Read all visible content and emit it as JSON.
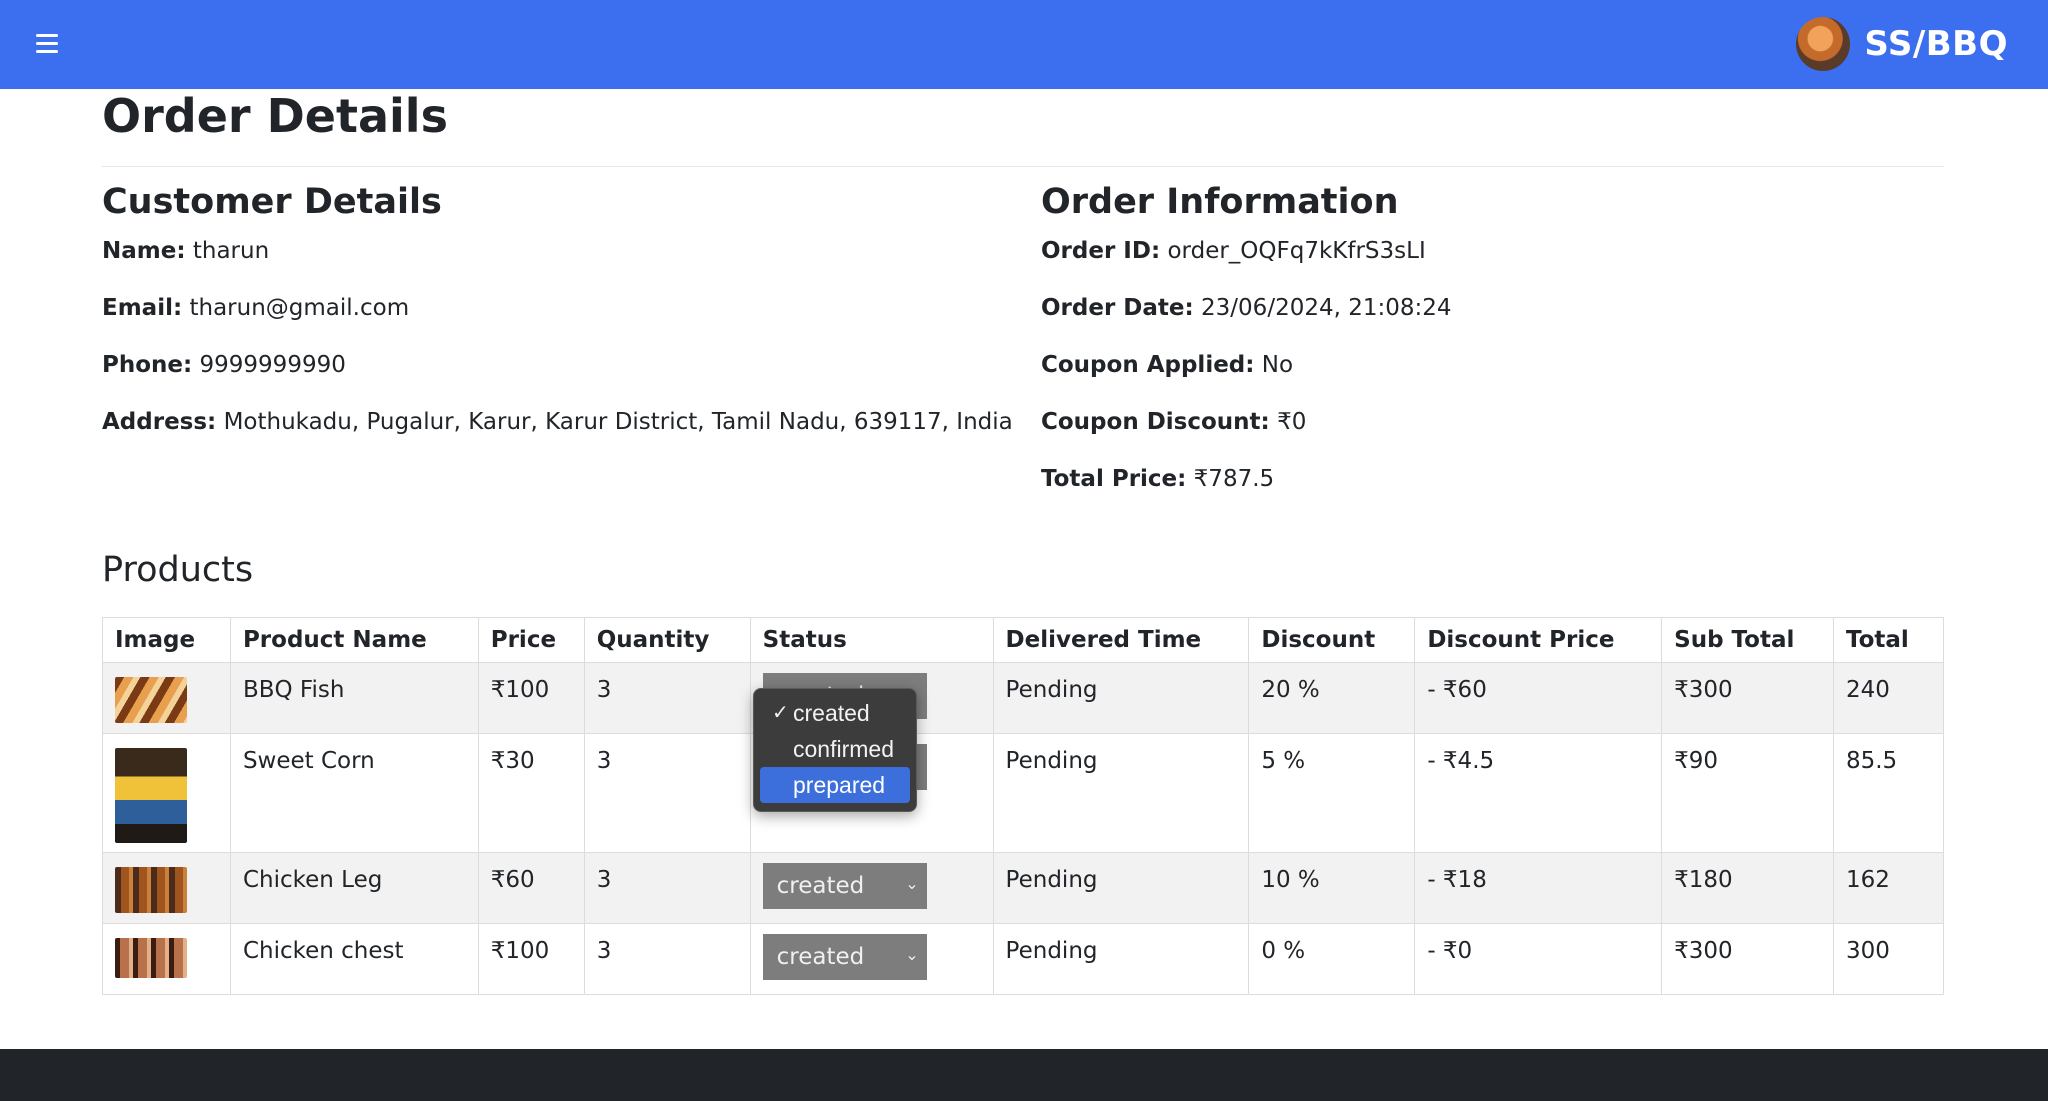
{
  "header": {
    "brand": "SS/BBQ",
    "colors": {
      "header_bg": "#3b6ff0",
      "footer_bg": "#212529"
    }
  },
  "page": {
    "title": "Order Details"
  },
  "customer": {
    "heading": "Customer Details",
    "rows": [
      {
        "label": "Name:",
        "value": "tharun"
      },
      {
        "label": "Email:",
        "value": "tharun@gmail.com"
      },
      {
        "label": "Phone:",
        "value": "9999999990"
      },
      {
        "label": "Address:",
        "value": "Mothukadu, Pugalur, Karur, Karur District, Tamil Nadu, 639117, India"
      }
    ]
  },
  "order": {
    "heading": "Order Information",
    "rows": [
      {
        "label": "Order ID:",
        "value": "order_OQFq7kKfrS3sLI"
      },
      {
        "label": "Order Date:",
        "value": "23/06/2024, 21:08:24"
      },
      {
        "label": "Coupon Applied:",
        "value": "No"
      },
      {
        "label": "Coupon Discount:",
        "value": "₹0"
      },
      {
        "label": "Total Price:",
        "value": "₹787.5"
      }
    ]
  },
  "products": {
    "heading": "Products",
    "columns": [
      "Image",
      "Product Name",
      "Price",
      "Quantity",
      "Status",
      "Delivered Time",
      "Discount",
      "Discount Price",
      "Sub Total",
      "Total"
    ],
    "rows": [
      {
        "image_icon": "bbq-fish-image",
        "name": "BBQ Fish",
        "price": "₹100",
        "quantity": "3",
        "status": "created",
        "delivered": "Pending",
        "discount": "20 %",
        "discount_price": "- ₹60",
        "sub_total": "₹300",
        "total": "240"
      },
      {
        "image_icon": "sweet-corn-image",
        "name": "Sweet Corn",
        "price": "₹30",
        "quantity": "3",
        "status": "created",
        "delivered": "Pending",
        "discount": "5 %",
        "discount_price": "- ₹4.5",
        "sub_total": "₹90",
        "total": "85.5"
      },
      {
        "image_icon": "chicken-leg-image",
        "name": "Chicken Leg",
        "price": "₹60",
        "quantity": "3",
        "status": "created",
        "delivered": "Pending",
        "discount": "10 %",
        "discount_price": "- ₹18",
        "sub_total": "₹180",
        "total": "162"
      },
      {
        "image_icon": "chicken-chest-image",
        "name": "Chicken chest",
        "price": "₹100",
        "quantity": "3",
        "status": "created",
        "delivered": "Pending",
        "discount": "0 %",
        "discount_price": "- ₹0",
        "sub_total": "₹300",
        "total": "300"
      }
    ]
  },
  "status_dropdown": {
    "options": [
      {
        "label": "created",
        "checked": true,
        "highlighted": false
      },
      {
        "label": "confirmed",
        "checked": false,
        "highlighted": false
      },
      {
        "label": "prepared",
        "checked": false,
        "highlighted": true
      }
    ],
    "check_glyph": "✓"
  }
}
